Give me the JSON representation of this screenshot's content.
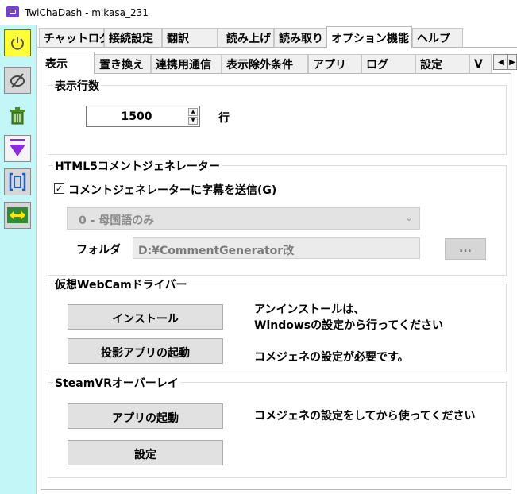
{
  "window": {
    "title": "TwiChaDash - mikasa_231"
  },
  "leftbar": {
    "buttons": [
      {
        "icon": "power-icon",
        "color": "#ffff33"
      },
      {
        "icon": "no-eye-icon"
      },
      {
        "icon": "trash-icon"
      },
      {
        "icon": "arrow-down-icon",
        "color": "#8a2be2"
      },
      {
        "icon": "bracket-icon"
      },
      {
        "icon": "swap-icon"
      }
    ],
    "background": "#c3f7f7"
  },
  "main_tabs": [
    {
      "label": "チャットログ"
    },
    {
      "label": "接続設定"
    },
    {
      "label": "翻訳"
    },
    {
      "label": "読み上げ"
    },
    {
      "label": "読み取り"
    },
    {
      "label": "オプション機能",
      "active": true
    },
    {
      "label": "ヘルプ"
    }
  ],
  "sub_tabs": [
    {
      "label": "表示",
      "active": true
    },
    {
      "label": "置き換え"
    },
    {
      "label": "連携用通信"
    },
    {
      "label": "表示除外条件"
    },
    {
      "label": "アプリ"
    },
    {
      "label": "ログ"
    },
    {
      "label": "設定"
    },
    {
      "label": "V"
    }
  ],
  "display_lines": {
    "title": "表示行数",
    "value": "1500",
    "unit": "行"
  },
  "html5": {
    "title": "HTML5コメントジェネレーター",
    "checkbox_label": "コメントジェネレーターに字幕を送信(G)",
    "checked": true,
    "select_value": "0 - 母国語のみ",
    "folder_label": "フォルダ",
    "folder_value": "D:¥CommentGenerator改",
    "browse_label": "..."
  },
  "webcam": {
    "title": "仮想WebCamドライバー",
    "install_label": "インストール",
    "launch_label": "投影アプリの起動",
    "note_line1": "アンインストールは、",
    "note_line2": "Windowsの設定から行ってください",
    "note_commegene": "コメジェネの設定が必要です。"
  },
  "steamvr": {
    "title": "SteamVRオーバーレイ",
    "launch_label": "アプリの起動",
    "settings_label": "設定",
    "note": "コメジェネの設定をしてから使ってください"
  }
}
